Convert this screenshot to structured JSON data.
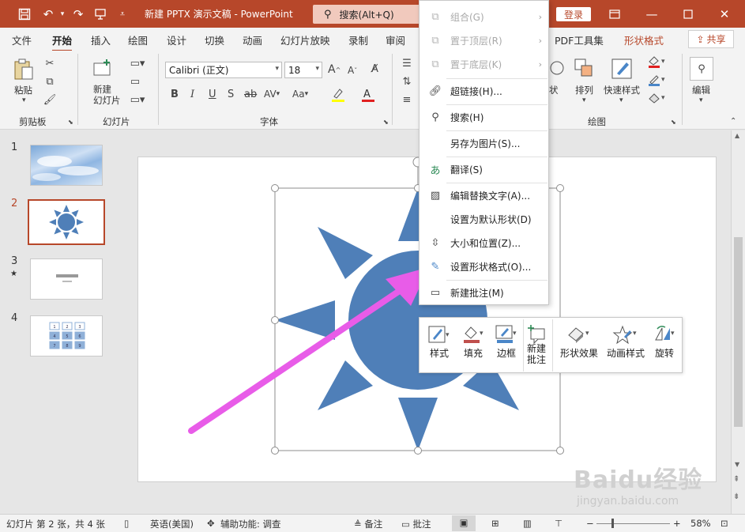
{
  "titlebar": {
    "doc_title": "新建 PPTX 演示文稿 - PowerPoint",
    "search_label": "搜索(Alt+Q)",
    "login_label": "登录"
  },
  "tabs": {
    "file": "文件",
    "home": "开始",
    "insert": "插入",
    "draw": "绘图",
    "design": "设计",
    "transitions": "切换",
    "animations": "动画",
    "slideshow": "幻灯片放映",
    "record": "录制",
    "review": "审阅",
    "pdf": "PDF工具集",
    "shape_format": "形状格式",
    "share": "共享"
  },
  "ribbon": {
    "paste": "粘贴",
    "clipboard": "剪贴板",
    "new_slide": "新建\n幻灯片",
    "slides_group": "幻灯片",
    "font_name": "Calibri (正文)",
    "font_size": "18",
    "font_group": "字体",
    "bold": "B",
    "italic": "I",
    "underline": "U",
    "shadow": "S",
    "strike": "ab",
    "spacing": "AV",
    "case": "Aa",
    "grow": "A",
    "shrink": "A",
    "shape_fill_right": "状",
    "arrange": "排列",
    "quick_styles": "快速样式",
    "drawing_group": "绘图",
    "edit": "编辑"
  },
  "slides": [
    {
      "num": "1",
      "star": ""
    },
    {
      "num": "2",
      "star": ""
    },
    {
      "num": "3",
      "star": "★"
    },
    {
      "num": "4",
      "star": ""
    }
  ],
  "thumb4_cells": [
    "1",
    "2",
    "3",
    "4",
    "5",
    "6",
    "7",
    "8",
    "9"
  ],
  "context_menu": [
    {
      "label": "组合(G)",
      "icon": "group-icon",
      "disabled": true,
      "arrow": true
    },
    {
      "label": "置于顶层(R)",
      "icon": "bring-front-icon",
      "disabled": true,
      "arrow": true
    },
    {
      "label": "置于底层(K)",
      "icon": "send-back-icon",
      "disabled": true,
      "arrow": true
    },
    {
      "label": "超链接(H)...",
      "icon": "link-icon",
      "disabled": false,
      "arrow": false
    },
    {
      "label": "搜索(H)",
      "icon": "search-icon",
      "disabled": false,
      "arrow": false
    },
    {
      "label": "另存为图片(S)...",
      "icon": "",
      "disabled": false,
      "arrow": false
    },
    {
      "label": "翻译(S)",
      "icon": "translate-icon",
      "disabled": false,
      "arrow": false
    },
    {
      "label": "编辑替换文字(A)...",
      "icon": "alt-text-icon",
      "disabled": false,
      "arrow": false
    },
    {
      "label": "设置为默认形状(D)",
      "icon": "",
      "disabled": false,
      "arrow": false
    },
    {
      "label": "大小和位置(Z)...",
      "icon": "size-position-icon",
      "disabled": false,
      "arrow": false
    },
    {
      "label": "设置形状格式(O)...",
      "icon": "format-shape-icon",
      "disabled": false,
      "arrow": false
    },
    {
      "label": "新建批注(M)",
      "icon": "new-comment-icon",
      "disabled": false,
      "arrow": false
    }
  ],
  "mini_toolbar": {
    "style": "样式",
    "fill": "填充",
    "border": "边框",
    "new_comment": "新建\n批注",
    "shape_effects": "形状效果",
    "animation_styles": "动画样式",
    "rotate": "旋转"
  },
  "status": {
    "slide_info": "幻灯片 第 2 张，共 4 张",
    "language": "英语(美国)",
    "accessibility": "辅助功能: 调查",
    "notes": "备注",
    "comments": "批注",
    "zoom": "58%"
  },
  "watermark": {
    "brand": "Baidu经验",
    "url": "jingyan.baidu.com"
  },
  "colors": {
    "accent": "#b7472a",
    "sun": "#4f7fb8",
    "arrow": "#e85ce8"
  }
}
